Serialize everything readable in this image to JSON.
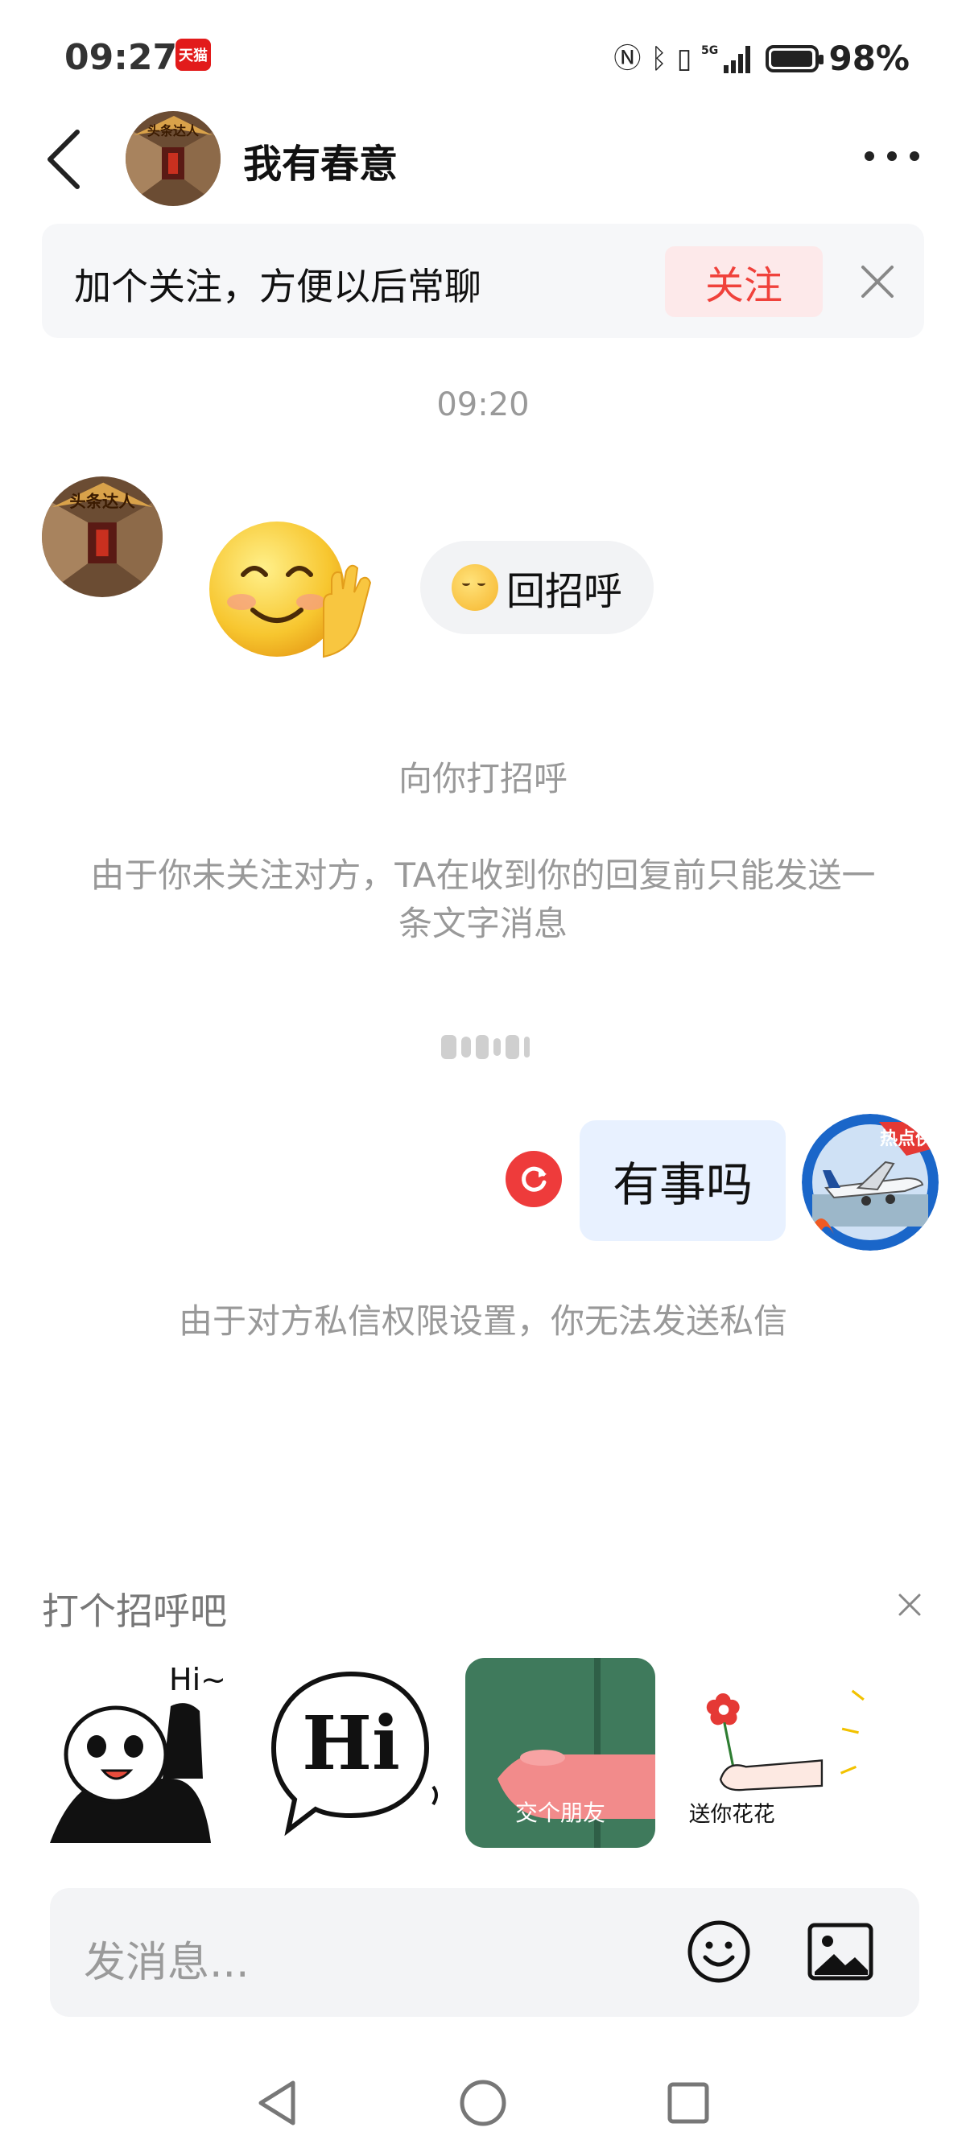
{
  "status_bar": {
    "time": "09:27",
    "app_badge": "天猫",
    "network": "5G",
    "battery": "98%",
    "battery_level": 0.98
  },
  "header": {
    "title": "我有春意",
    "avatar_badge": "头条达人"
  },
  "follow_banner": {
    "text": "加个关注，方便以后常聊",
    "button": "关注"
  },
  "chat": {
    "timestamp": "09:20",
    "reply_chip": "回招呼",
    "system_1": "向你打招呼",
    "system_2": "由于你未关注对方，TA在收到你的回复前只能发送一条文字消息",
    "outgoing_message": "有事吗",
    "outgoing_avatar_badge": "热点侠",
    "system_3": "由于对方私信权限设置，你无法发送私信"
  },
  "greetings": {
    "title": "打个招呼吧",
    "stickers": [
      {
        "name": "panda-hi",
        "caption": "Hi~"
      },
      {
        "name": "hi-bubble",
        "caption": "Hi"
      },
      {
        "name": "make-friend",
        "caption": "交个朋友"
      },
      {
        "name": "flower-gift",
        "caption": "送你花花"
      }
    ]
  },
  "input": {
    "placeholder": "发消息..."
  },
  "colors": {
    "accent_red": "#f0413b",
    "outgoing_bubble": "#e8f1ff",
    "banner_bg": "#f6f7f9"
  }
}
